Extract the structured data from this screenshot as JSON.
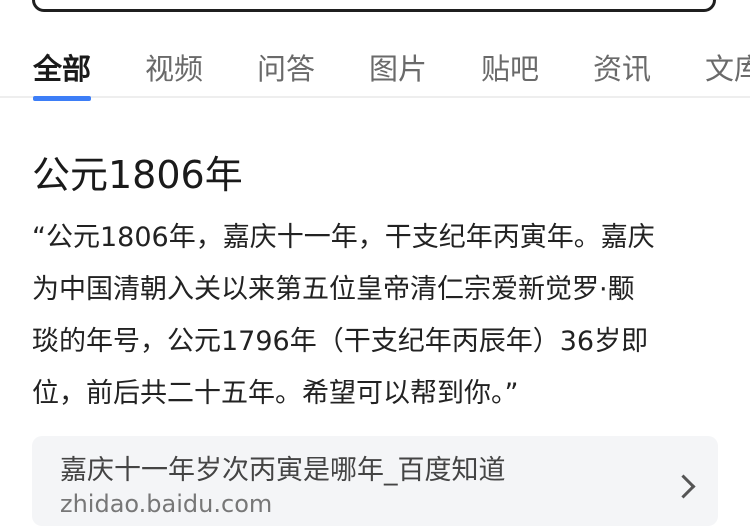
{
  "tabs": [
    {
      "label": "全部",
      "active": true
    },
    {
      "label": "视频"
    },
    {
      "label": "问答"
    },
    {
      "label": "图片"
    },
    {
      "label": "贴吧"
    },
    {
      "label": "资讯"
    },
    {
      "label": "文库"
    }
  ],
  "answer": {
    "title": "公元1806年",
    "lines": [
      "“公元1806年，嘉庆十一年，干支纪年丙寅年。嘉庆",
      "为中国清朝入关以来第五位皇帝清仁宗爱新觉罗·颙",
      "琰的年号，公元1796年（干支纪年丙辰年）36岁即",
      "位，前后共二十五年。希望可以帮到你。”"
    ]
  },
  "source": {
    "title": "嘉庆十一年岁次丙寅是哪年_百度知道",
    "url": "zhidao.baidu.com"
  },
  "colors": {
    "accent": "#3d7ef7",
    "card_bg": "#f4f5f7"
  }
}
